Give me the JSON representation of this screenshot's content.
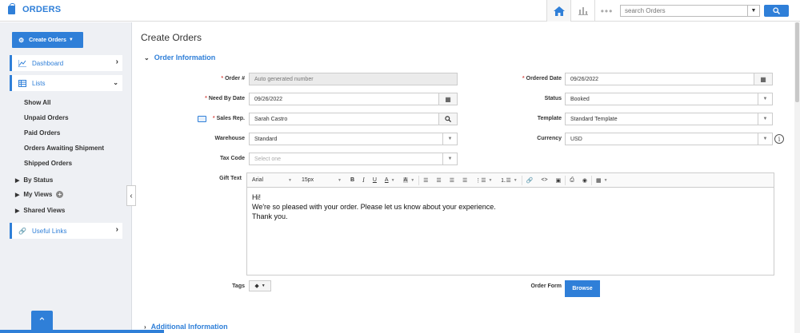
{
  "app": {
    "title": "ORDERS",
    "brand_color": "#2f7fd8",
    "icons": {
      "brand": "shopping-bag-icon",
      "home": "home-icon",
      "reports": "bar-chart-icon",
      "more": "more-dots-icon"
    }
  },
  "search": {
    "placeholder": "search Orders",
    "value": ""
  },
  "sidebar": {
    "create_button": "Create Orders",
    "dashboard": "Dashboard",
    "lists": "Lists",
    "list_items": [
      "Show All",
      "Unpaid Orders",
      "Paid Orders",
      "Orders Awaiting Shipment",
      "Shipped Orders"
    ],
    "by_status": "By Status",
    "my_views": "My Views",
    "shared_views": "Shared Views",
    "useful_links": "Useful Links"
  },
  "main": {
    "page_title": "Create Orders",
    "section_order_info": "Order Information",
    "section_additional": "Additional Information",
    "fields": {
      "order_no_label": "Order #",
      "order_no_value": "Auto generated number",
      "need_by_label": "Need By Date",
      "need_by_value": "09/26/2022",
      "sales_rep_label": "Sales Rep.",
      "sales_rep_value": "Sarah Castro",
      "warehouse_label": "Warehouse",
      "warehouse_value": "Standard",
      "tax_code_label": "Tax Code",
      "tax_code_placeholder": "Select one",
      "ordered_date_label": "Ordered Date",
      "ordered_date_value": "09/26/2022",
      "status_label": "Status",
      "status_value": "Booked",
      "template_label": "Template",
      "template_value": "Standard Template",
      "currency_label": "Currency",
      "currency_value": "USD",
      "gift_text_label": "Gift Text",
      "tags_label": "Tags",
      "order_form_label": "Order Form",
      "browse_button": "Browse"
    },
    "editor": {
      "font": "Arial",
      "size": "15px",
      "line1": "Hi!",
      "line2": "We're so pleased with your order. Please let us know about your experience.",
      "line3": "Thank you."
    }
  }
}
